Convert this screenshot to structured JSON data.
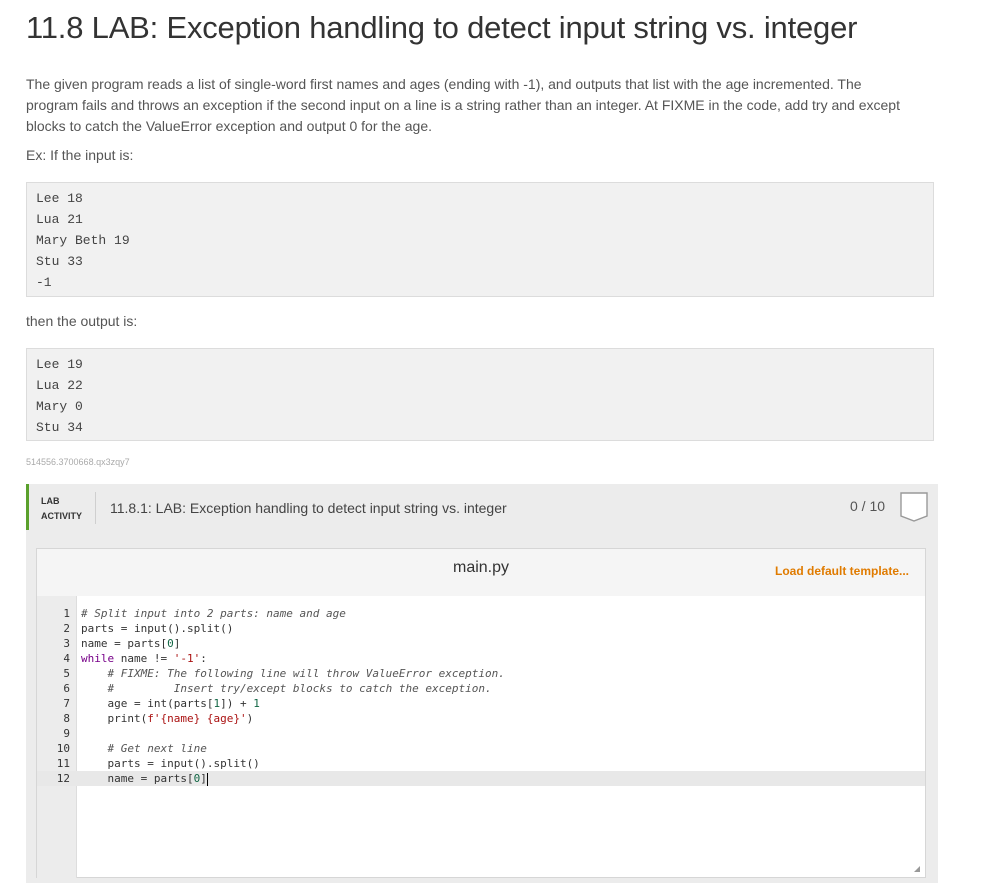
{
  "title": "11.8 LAB: Exception handling to detect input string vs. integer",
  "description": "The given program reads a list of single-word first names and ages (ending with -1), and outputs that list with the age incremented. The program fails and throws an exception if the second input on a line is a string rather than an integer. At FIXME in the code, add try and except blocks to catch the ValueError exception and output 0 for the age.",
  "example_label": "Ex: If the input is:",
  "example_input": [
    "Lee 18",
    "Lua 21",
    "Mary Beth 19",
    "Stu 33",
    "-1"
  ],
  "output_label": "then the output is:",
  "example_output": [
    "Lee 19",
    "Lua 22",
    "Mary 0",
    "Stu 34"
  ],
  "content_id": "514556.3700668.qx3zqy7",
  "lab": {
    "tag_line1": "LAB",
    "tag_line2": "ACTIVITY",
    "title": "11.8.1: LAB: Exception handling to detect input string vs. integer",
    "score": "0 / 10",
    "accent_color": "#5aa02c"
  },
  "editor": {
    "filename": "main.py",
    "load_template_label": "Load default template...",
    "load_color": "#e07b00",
    "line_numbers": [
      "1",
      "2",
      "3",
      "4",
      "5",
      "6",
      "7",
      "8",
      "9",
      "10",
      "11",
      "12"
    ]
  }
}
